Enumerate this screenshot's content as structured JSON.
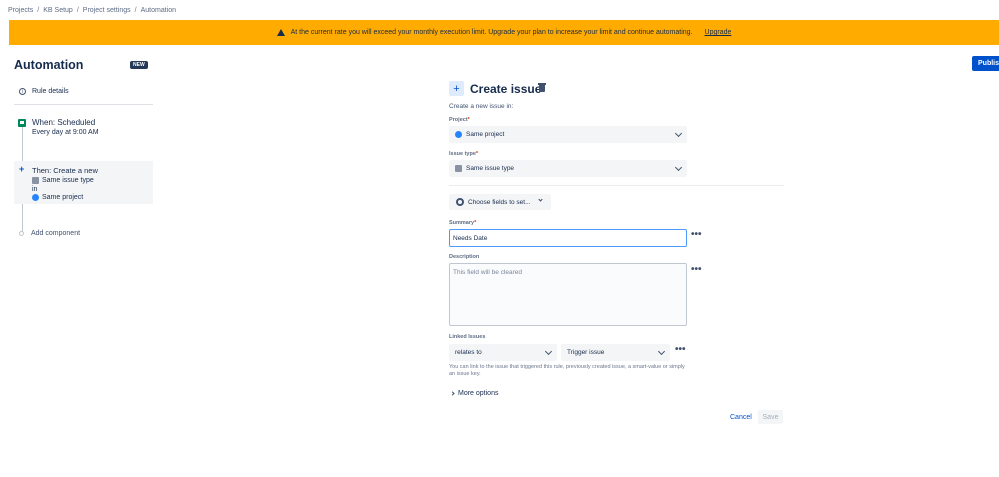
{
  "breadcrumb": [
    "Projects",
    "KB Setup",
    "Project settings",
    "Automation"
  ],
  "banner": {
    "message": "At the current rate you will exceed your monthly execution limit. Upgrade your plan to increase your limit and continue automating.",
    "link": "Upgrade",
    "color": "#ffab00"
  },
  "sidebar": {
    "title": "Automation",
    "badge": "NEW",
    "rule_details": "Rule details",
    "trigger": {
      "title": "When: Scheduled",
      "subtitle": "Every day at 9:00 AM"
    },
    "action": {
      "title": "Then: Create a new",
      "line1": "Same issue type",
      "line2": "in",
      "line3": "Same project"
    },
    "add_component": "Add component"
  },
  "toolbar": {
    "publish": "Publish"
  },
  "form": {
    "title": "Create issue",
    "subtitle": "Create a new issue in:",
    "project_label": "Project",
    "project_value": "Same project",
    "issue_type_label": "Issue type",
    "issue_type_value": "Same issue type",
    "choose_fields": "Choose fields to set...",
    "summary_label": "Summary",
    "summary_value": "Needs Date",
    "description_label": "Description",
    "description_placeholder": "This field will be cleared",
    "linked_label": "Linked Issues",
    "linked_relation": "relates to",
    "linked_target": "Trigger issue",
    "linked_help": "You can link to the issue that triggered this rule, previously created issue, a smart-value or simply an issue key.",
    "more_options": "More options",
    "required_mark": "*",
    "cancel": "Cancel",
    "save": "Save"
  },
  "colors": {
    "accent": "#0052cc",
    "focus": "#4c9aff"
  }
}
